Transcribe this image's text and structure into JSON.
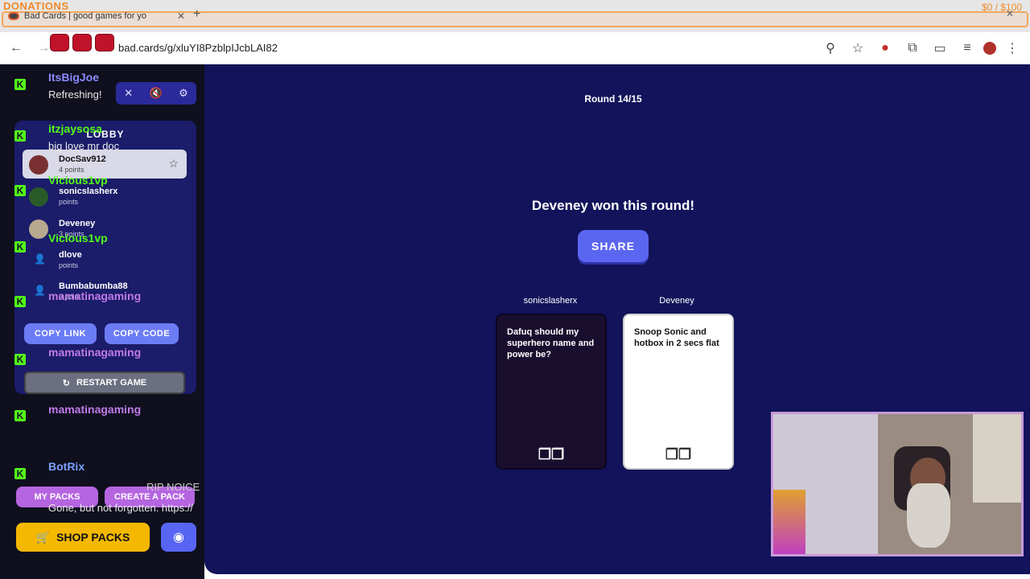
{
  "browser": {
    "donations_label": "DONATIONS",
    "donation_amount": "$0 / $100",
    "tab_title": "Bad Cards | good games for yo",
    "url": "bad.cards/g/xluYI8PzblpIJcbLAI82"
  },
  "chat": {
    "messages": [
      {
        "user": "ItsBigJoe",
        "text": "Refreshing!",
        "color": "#8b8bff"
      },
      {
        "user": "itzjaysosa",
        "text": "big love mr doc",
        "color": "#53fc18"
      },
      {
        "user": "Vicious1vp",
        "text": "",
        "color": "#53fc18"
      },
      {
        "user": "Vicious1vp",
        "text": "",
        "color": "#53fc18"
      },
      {
        "user": "mamatinagaming",
        "text": "",
        "color": "#c07ae8"
      },
      {
        "user": "mamatinagaming",
        "text": "",
        "color": "#c07ae8"
      },
      {
        "user": "mamatinagaming",
        "text": "",
        "color": "#c07ae8"
      },
      {
        "user": "BotRix",
        "text": "Gone, but not forgotten. https://",
        "color": "#7aa0ff"
      }
    ],
    "overlay_text": "RIP NOICE"
  },
  "lobby": {
    "title": "LOBBY",
    "players": [
      {
        "name": "DocSav912",
        "points": "4 points"
      },
      {
        "name": "sonicslasherx",
        "points": "points"
      },
      {
        "name": "Deveney",
        "points": "3 points"
      },
      {
        "name": "dlove",
        "points": "points"
      },
      {
        "name": "Bumbabumba88",
        "points": "0 point"
      }
    ],
    "copy_link": "COPY LINK",
    "copy_code": "COPY CODE",
    "restart": "RESTART GAME",
    "my_packs": "MY PACKS",
    "create_pack": "CREATE A PACK",
    "shop_packs": "SHOP PACKS"
  },
  "game": {
    "round": "Round 14/15",
    "winner_text": "Deveney won this round!",
    "share": "SHARE",
    "black_card": {
      "player": "sonicslasherx",
      "text": "Dafuq should my superhero name and power be?"
    },
    "white_card": {
      "player": "Deveney",
      "text": "Snoop Sonic and hotbox in 2 secs flat"
    }
  }
}
